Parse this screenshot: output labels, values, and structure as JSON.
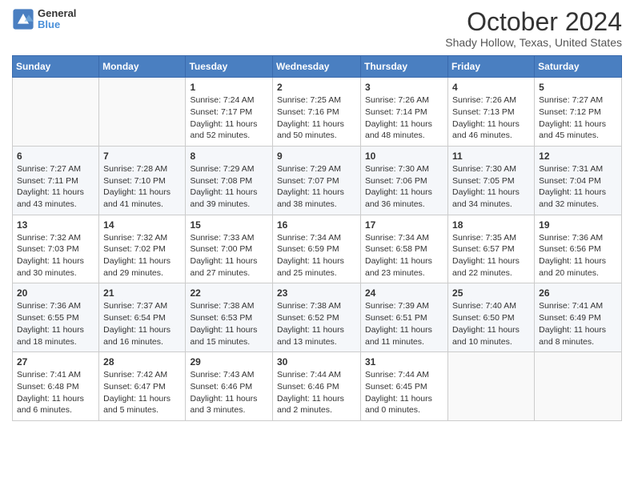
{
  "header": {
    "logo_line1": "General",
    "logo_line2": "Blue",
    "month_title": "October 2024",
    "location": "Shady Hollow, Texas, United States"
  },
  "days_of_week": [
    "Sunday",
    "Monday",
    "Tuesday",
    "Wednesday",
    "Thursday",
    "Friday",
    "Saturday"
  ],
  "weeks": [
    [
      {
        "day": "",
        "sunrise": "",
        "sunset": "",
        "daylight": ""
      },
      {
        "day": "",
        "sunrise": "",
        "sunset": "",
        "daylight": ""
      },
      {
        "day": "1",
        "sunrise": "Sunrise: 7:24 AM",
        "sunset": "Sunset: 7:17 PM",
        "daylight": "Daylight: 11 hours and 52 minutes."
      },
      {
        "day": "2",
        "sunrise": "Sunrise: 7:25 AM",
        "sunset": "Sunset: 7:16 PM",
        "daylight": "Daylight: 11 hours and 50 minutes."
      },
      {
        "day": "3",
        "sunrise": "Sunrise: 7:26 AM",
        "sunset": "Sunset: 7:14 PM",
        "daylight": "Daylight: 11 hours and 48 minutes."
      },
      {
        "day": "4",
        "sunrise": "Sunrise: 7:26 AM",
        "sunset": "Sunset: 7:13 PM",
        "daylight": "Daylight: 11 hours and 46 minutes."
      },
      {
        "day": "5",
        "sunrise": "Sunrise: 7:27 AM",
        "sunset": "Sunset: 7:12 PM",
        "daylight": "Daylight: 11 hours and 45 minutes."
      }
    ],
    [
      {
        "day": "6",
        "sunrise": "Sunrise: 7:27 AM",
        "sunset": "Sunset: 7:11 PM",
        "daylight": "Daylight: 11 hours and 43 minutes."
      },
      {
        "day": "7",
        "sunrise": "Sunrise: 7:28 AM",
        "sunset": "Sunset: 7:10 PM",
        "daylight": "Daylight: 11 hours and 41 minutes."
      },
      {
        "day": "8",
        "sunrise": "Sunrise: 7:29 AM",
        "sunset": "Sunset: 7:08 PM",
        "daylight": "Daylight: 11 hours and 39 minutes."
      },
      {
        "day": "9",
        "sunrise": "Sunrise: 7:29 AM",
        "sunset": "Sunset: 7:07 PM",
        "daylight": "Daylight: 11 hours and 38 minutes."
      },
      {
        "day": "10",
        "sunrise": "Sunrise: 7:30 AM",
        "sunset": "Sunset: 7:06 PM",
        "daylight": "Daylight: 11 hours and 36 minutes."
      },
      {
        "day": "11",
        "sunrise": "Sunrise: 7:30 AM",
        "sunset": "Sunset: 7:05 PM",
        "daylight": "Daylight: 11 hours and 34 minutes."
      },
      {
        "day": "12",
        "sunrise": "Sunrise: 7:31 AM",
        "sunset": "Sunset: 7:04 PM",
        "daylight": "Daylight: 11 hours and 32 minutes."
      }
    ],
    [
      {
        "day": "13",
        "sunrise": "Sunrise: 7:32 AM",
        "sunset": "Sunset: 7:03 PM",
        "daylight": "Daylight: 11 hours and 30 minutes."
      },
      {
        "day": "14",
        "sunrise": "Sunrise: 7:32 AM",
        "sunset": "Sunset: 7:02 PM",
        "daylight": "Daylight: 11 hours and 29 minutes."
      },
      {
        "day": "15",
        "sunrise": "Sunrise: 7:33 AM",
        "sunset": "Sunset: 7:00 PM",
        "daylight": "Daylight: 11 hours and 27 minutes."
      },
      {
        "day": "16",
        "sunrise": "Sunrise: 7:34 AM",
        "sunset": "Sunset: 6:59 PM",
        "daylight": "Daylight: 11 hours and 25 minutes."
      },
      {
        "day": "17",
        "sunrise": "Sunrise: 7:34 AM",
        "sunset": "Sunset: 6:58 PM",
        "daylight": "Daylight: 11 hours and 23 minutes."
      },
      {
        "day": "18",
        "sunrise": "Sunrise: 7:35 AM",
        "sunset": "Sunset: 6:57 PM",
        "daylight": "Daylight: 11 hours and 22 minutes."
      },
      {
        "day": "19",
        "sunrise": "Sunrise: 7:36 AM",
        "sunset": "Sunset: 6:56 PM",
        "daylight": "Daylight: 11 hours and 20 minutes."
      }
    ],
    [
      {
        "day": "20",
        "sunrise": "Sunrise: 7:36 AM",
        "sunset": "Sunset: 6:55 PM",
        "daylight": "Daylight: 11 hours and 18 minutes."
      },
      {
        "day": "21",
        "sunrise": "Sunrise: 7:37 AM",
        "sunset": "Sunset: 6:54 PM",
        "daylight": "Daylight: 11 hours and 16 minutes."
      },
      {
        "day": "22",
        "sunrise": "Sunrise: 7:38 AM",
        "sunset": "Sunset: 6:53 PM",
        "daylight": "Daylight: 11 hours and 15 minutes."
      },
      {
        "day": "23",
        "sunrise": "Sunrise: 7:38 AM",
        "sunset": "Sunset: 6:52 PM",
        "daylight": "Daylight: 11 hours and 13 minutes."
      },
      {
        "day": "24",
        "sunrise": "Sunrise: 7:39 AM",
        "sunset": "Sunset: 6:51 PM",
        "daylight": "Daylight: 11 hours and 11 minutes."
      },
      {
        "day": "25",
        "sunrise": "Sunrise: 7:40 AM",
        "sunset": "Sunset: 6:50 PM",
        "daylight": "Daylight: 11 hours and 10 minutes."
      },
      {
        "day": "26",
        "sunrise": "Sunrise: 7:41 AM",
        "sunset": "Sunset: 6:49 PM",
        "daylight": "Daylight: 11 hours and 8 minutes."
      }
    ],
    [
      {
        "day": "27",
        "sunrise": "Sunrise: 7:41 AM",
        "sunset": "Sunset: 6:48 PM",
        "daylight": "Daylight: 11 hours and 6 minutes."
      },
      {
        "day": "28",
        "sunrise": "Sunrise: 7:42 AM",
        "sunset": "Sunset: 6:47 PM",
        "daylight": "Daylight: 11 hours and 5 minutes."
      },
      {
        "day": "29",
        "sunrise": "Sunrise: 7:43 AM",
        "sunset": "Sunset: 6:46 PM",
        "daylight": "Daylight: 11 hours and 3 minutes."
      },
      {
        "day": "30",
        "sunrise": "Sunrise: 7:44 AM",
        "sunset": "Sunset: 6:46 PM",
        "daylight": "Daylight: 11 hours and 2 minutes."
      },
      {
        "day": "31",
        "sunrise": "Sunrise: 7:44 AM",
        "sunset": "Sunset: 6:45 PM",
        "daylight": "Daylight: 11 hours and 0 minutes."
      },
      {
        "day": "",
        "sunrise": "",
        "sunset": "",
        "daylight": ""
      },
      {
        "day": "",
        "sunrise": "",
        "sunset": "",
        "daylight": ""
      }
    ]
  ]
}
